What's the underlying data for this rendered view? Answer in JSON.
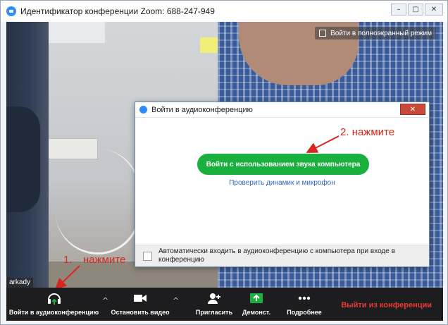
{
  "window": {
    "title": "Идентификатор конференции Zoom: 688-247-949",
    "controls": [
      "–",
      "▢",
      "✕"
    ]
  },
  "video": {
    "fullscreen_label": "Войти в полноэкранный режим",
    "participant_name": "arkady"
  },
  "annotations": {
    "step1_number": "1.",
    "step1_text": "нажмите",
    "step2_text": "2. нажмите",
    "color": "#d8261c"
  },
  "dialog": {
    "title": "Войти в аудиоконференцию",
    "close_glyph": "✕",
    "join_button": "Войти с использованием звука компьютера",
    "test_link": "Проверить динамик и микрофон",
    "auto_join_label": "Автоматически входить в аудиоконференцию с компьютера при входе в конференцию",
    "auto_join_checked": false
  },
  "toolbar": {
    "join_audio": "Войти в аудиоконференцию",
    "stop_video": "Остановить видео",
    "invite": "Пригласить",
    "share": "Демонст.",
    "more": "Подробнее",
    "leave": "Выйти из конференции",
    "chevron": "^",
    "leave_color": "#e83a35",
    "share_color": "#19b03e"
  }
}
